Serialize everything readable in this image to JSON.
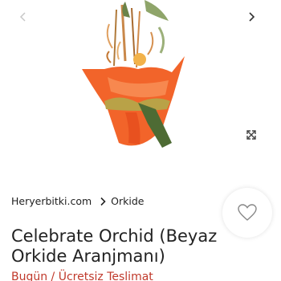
{
  "colors": {
    "accent_orange": "#f2642a",
    "leaf_green": "#5a7a3a",
    "delivery_red": "#c0392b",
    "text_dark": "#222222"
  },
  "gallery": {
    "prev_icon": "chevron-left-icon",
    "next_icon": "chevron-right-icon",
    "zoom_icon": "expand-icon",
    "image_alt": "Orange wrapped orchid arrangement"
  },
  "breadcrumb": {
    "items": [
      {
        "label": "Heryerbitki.com"
      },
      {
        "label": "Orkide"
      }
    ],
    "separator_icon": "chevron-right-icon"
  },
  "favorite": {
    "icon": "heart-icon"
  },
  "product": {
    "title": "Celebrate Orchid (Beyaz Orkide Aranjmanı)",
    "delivery": "Bugün / Ücretsiz Teslimat"
  }
}
